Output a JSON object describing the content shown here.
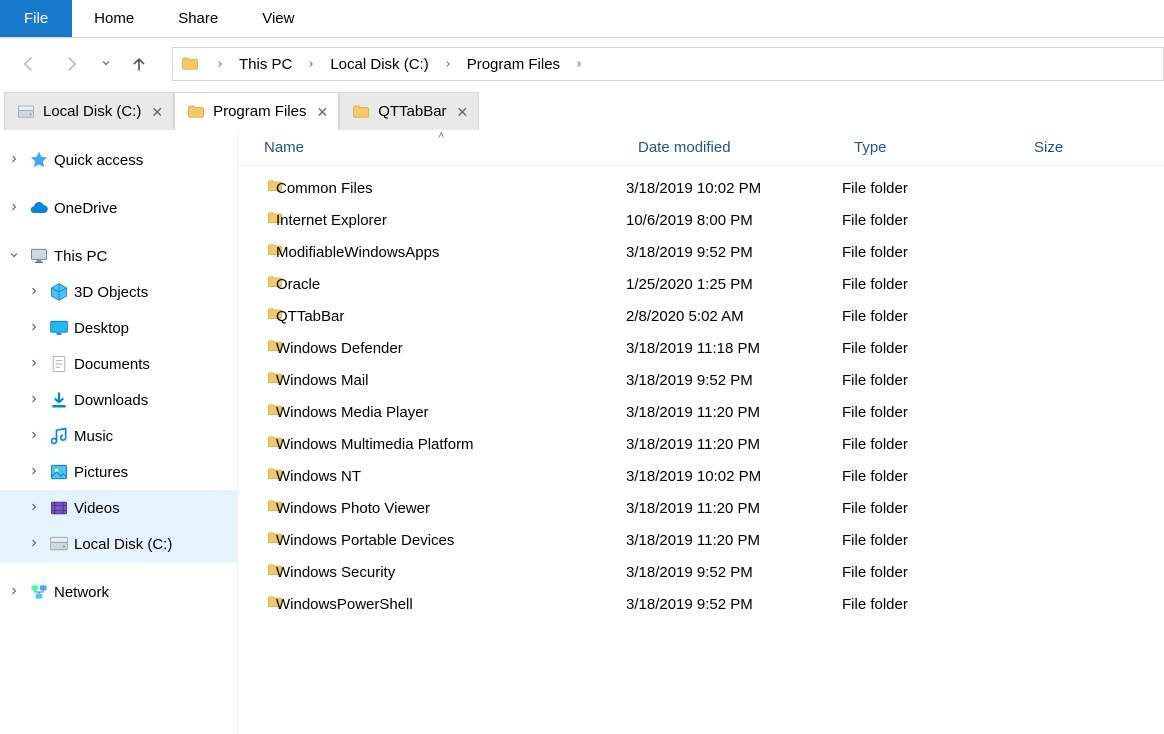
{
  "ribbon": {
    "file": "File",
    "tabs": [
      "Home",
      "Share",
      "View"
    ]
  },
  "breadcrumb": [
    "This PC",
    "Local Disk (C:)",
    "Program Files"
  ],
  "qtabs": [
    {
      "label": "Local Disk (C:)",
      "icon": "drive",
      "active": false
    },
    {
      "label": "Program Files",
      "icon": "folder",
      "active": true
    },
    {
      "label": "QTTabBar",
      "icon": "folder",
      "active": false
    }
  ],
  "sidebar": {
    "quick_access": "Quick access",
    "onedrive": "OneDrive",
    "this_pc": "This PC",
    "pc_children": [
      {
        "key": "3dobj",
        "label": "3D Objects",
        "icon": "cube"
      },
      {
        "key": "desktop",
        "label": "Desktop",
        "icon": "desktop"
      },
      {
        "key": "documents",
        "label": "Documents",
        "icon": "doc"
      },
      {
        "key": "downloads",
        "label": "Downloads",
        "icon": "download"
      },
      {
        "key": "music",
        "label": "Music",
        "icon": "music"
      },
      {
        "key": "pictures",
        "label": "Pictures",
        "icon": "picture"
      },
      {
        "key": "videos",
        "label": "Videos",
        "icon": "video"
      },
      {
        "key": "localdisk",
        "label": "Local Disk (C:)",
        "icon": "drive"
      }
    ],
    "network": "Network"
  },
  "columns": {
    "name": "Name",
    "date": "Date modified",
    "type": "Type",
    "size": "Size"
  },
  "files": [
    {
      "name": "Common Files",
      "date": "3/18/2019 10:02 PM",
      "type": "File folder"
    },
    {
      "name": "Internet Explorer",
      "date": "10/6/2019 8:00 PM",
      "type": "File folder"
    },
    {
      "name": "ModifiableWindowsApps",
      "date": "3/18/2019 9:52 PM",
      "type": "File folder"
    },
    {
      "name": "Oracle",
      "date": "1/25/2020 1:25 PM",
      "type": "File folder"
    },
    {
      "name": "QTTabBar",
      "date": "2/8/2020 5:02 AM",
      "type": "File folder"
    },
    {
      "name": "Windows Defender",
      "date": "3/18/2019 11:18 PM",
      "type": "File folder"
    },
    {
      "name": "Windows Mail",
      "date": "3/18/2019 9:52 PM",
      "type": "File folder"
    },
    {
      "name": "Windows Media Player",
      "date": "3/18/2019 11:20 PM",
      "type": "File folder"
    },
    {
      "name": "Windows Multimedia Platform",
      "date": "3/18/2019 11:20 PM",
      "type": "File folder"
    },
    {
      "name": "Windows NT",
      "date": "3/18/2019 10:02 PM",
      "type": "File folder"
    },
    {
      "name": "Windows Photo Viewer",
      "date": "3/18/2019 11:20 PM",
      "type": "File folder"
    },
    {
      "name": "Windows Portable Devices",
      "date": "3/18/2019 11:20 PM",
      "type": "File folder"
    },
    {
      "name": "Windows Security",
      "date": "3/18/2019 9:52 PM",
      "type": "File folder"
    },
    {
      "name": "WindowsPowerShell",
      "date": "3/18/2019 9:52 PM",
      "type": "File folder"
    }
  ]
}
